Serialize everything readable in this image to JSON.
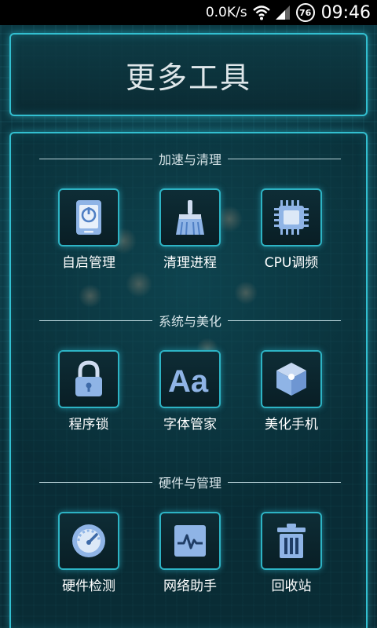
{
  "status_bar": {
    "net_speed": "0.0K/s",
    "battery_level": "76",
    "time": "09:46"
  },
  "header": {
    "title": "更多工具"
  },
  "sections": [
    {
      "title": "加速与清理",
      "items": [
        {
          "label": "自启管理",
          "icon": "startup-phone-icon"
        },
        {
          "label": "清理进程",
          "icon": "broom-icon"
        },
        {
          "label": "CPU调频",
          "icon": "cpu-chip-icon"
        }
      ]
    },
    {
      "title": "系统与美化",
      "items": [
        {
          "label": "程序锁",
          "icon": "padlock-icon"
        },
        {
          "label": "字体管家",
          "icon": "font-aa-icon"
        },
        {
          "label": "美化手机",
          "icon": "cube-icon"
        }
      ]
    },
    {
      "title": "硬件与管理",
      "items": [
        {
          "label": "硬件检测",
          "icon": "speedometer-icon"
        },
        {
          "label": "网络助手",
          "icon": "pulse-monitor-icon"
        },
        {
          "label": "回收站",
          "icon": "trash-bin-icon"
        }
      ]
    }
  ],
  "colors": {
    "accent_cyan": "#32bfd0",
    "icon_blue": "#8fb4e6"
  }
}
